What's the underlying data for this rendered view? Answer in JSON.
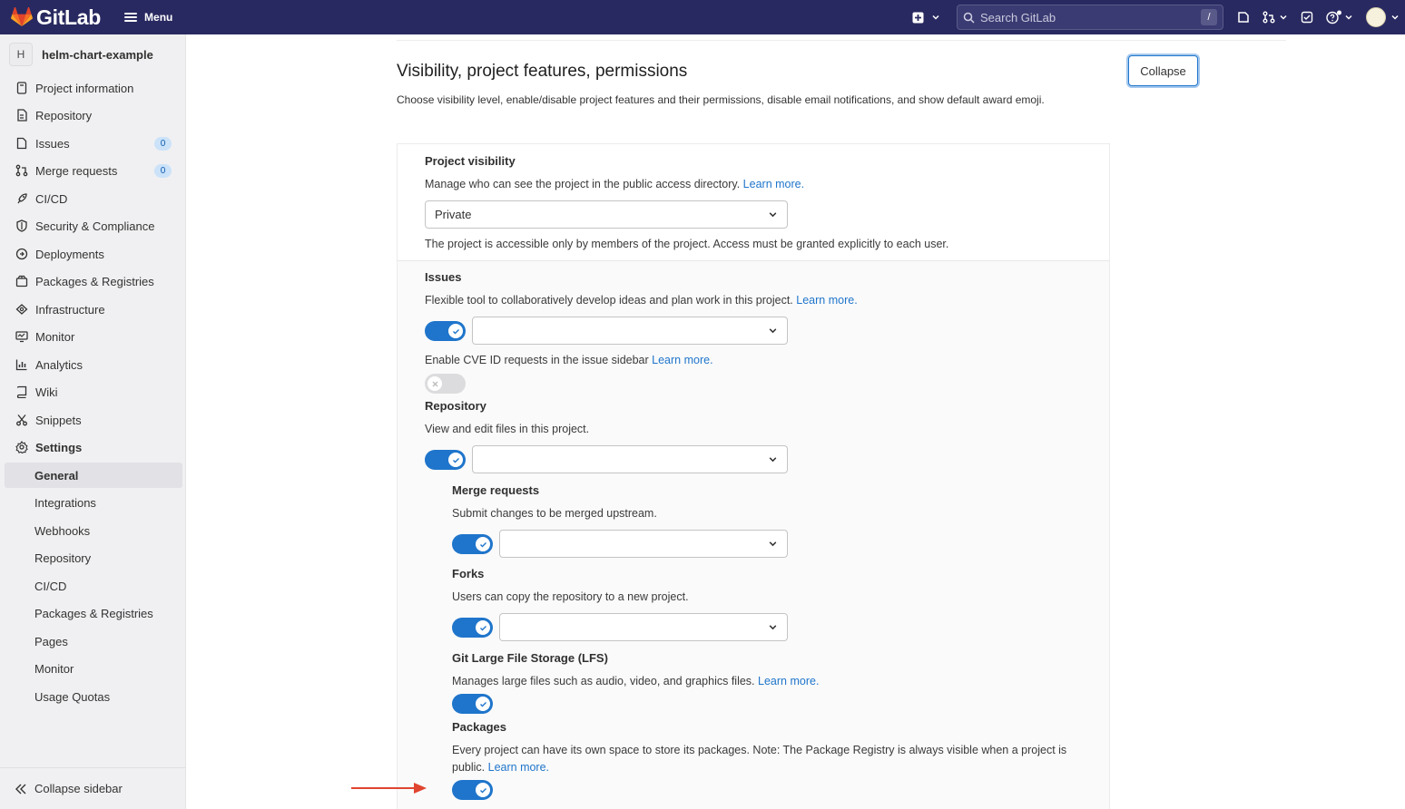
{
  "topbar": {
    "brand": "GitLab",
    "menu_label": "Menu",
    "search_placeholder": "Search GitLab",
    "search_shortcut": "/",
    "icons": [
      "plus-square-icon",
      "chevron-down-icon",
      "issues-icon",
      "merge-request-icon",
      "todo-icon",
      "help-icon",
      "user-avatar"
    ]
  },
  "sidebar": {
    "project_initial": "H",
    "project_name": "helm-chart-example",
    "items": [
      {
        "label": "Project information",
        "icon": "project-info-icon"
      },
      {
        "label": "Repository",
        "icon": "repository-icon"
      },
      {
        "label": "Issues",
        "icon": "issues-icon",
        "badge": "0"
      },
      {
        "label": "Merge requests",
        "icon": "merge-request-icon",
        "badge": "0"
      },
      {
        "label": "CI/CD",
        "icon": "rocket-icon"
      },
      {
        "label": "Security & Compliance",
        "icon": "shield-icon"
      },
      {
        "label": "Deployments",
        "icon": "deployments-icon"
      },
      {
        "label": "Packages & Registries",
        "icon": "package-icon"
      },
      {
        "label": "Infrastructure",
        "icon": "cloud-icon"
      },
      {
        "label": "Monitor",
        "icon": "monitor-icon"
      },
      {
        "label": "Analytics",
        "icon": "chart-icon"
      },
      {
        "label": "Wiki",
        "icon": "book-icon"
      },
      {
        "label": "Snippets",
        "icon": "scissors-icon"
      },
      {
        "label": "Settings",
        "icon": "settings-icon"
      }
    ],
    "settings_sub": [
      "General",
      "Integrations",
      "Webhooks",
      "Repository",
      "CI/CD",
      "Packages & Registries",
      "Pages",
      "Monitor",
      "Usage Quotas"
    ],
    "active_sub": "General",
    "collapse_label": "Collapse sidebar"
  },
  "section": {
    "title": "Visibility, project features, permissions",
    "description": "Choose visibility level, enable/disable project features and their permissions, disable email notifications, and show default award emoji.",
    "collapse_button": "Collapse"
  },
  "visibility": {
    "label": "Project visibility",
    "help": "Manage who can see the project in the public access directory.",
    "learn_more": "Learn more.",
    "value": "Private",
    "note": "The project is accessible only by members of the project. Access must be granted explicitly to each user."
  },
  "issues": {
    "label": "Issues",
    "help": "Flexible tool to collaboratively develop ideas and plan work in this project.",
    "learn_more": "Learn more.",
    "enabled": true,
    "cve_help": "Enable CVE ID requests in the issue sidebar",
    "cve_learn_more": "Learn more.",
    "cve_enabled": false
  },
  "repository": {
    "label": "Repository",
    "help": "View and edit files in this project.",
    "enabled": true
  },
  "merge_requests": {
    "label": "Merge requests",
    "help": "Submit changes to be merged upstream.",
    "enabled": true
  },
  "forks": {
    "label": "Forks",
    "help": "Users can copy the repository to a new project.",
    "enabled": true
  },
  "lfs": {
    "label": "Git Large File Storage (LFS)",
    "help": "Manages large files such as audio, video, and graphics files.",
    "learn_more": "Learn more.",
    "enabled": true
  },
  "packages": {
    "label": "Packages",
    "help": "Every project can have its own space to store its packages. Note: The Package Registry is always visible when a project is public.",
    "learn_more": "Learn more.",
    "enabled": true
  },
  "colors": {
    "topbar": "#292961",
    "accent": "#1f75cb",
    "annotation_arrow": "#e0452f"
  }
}
